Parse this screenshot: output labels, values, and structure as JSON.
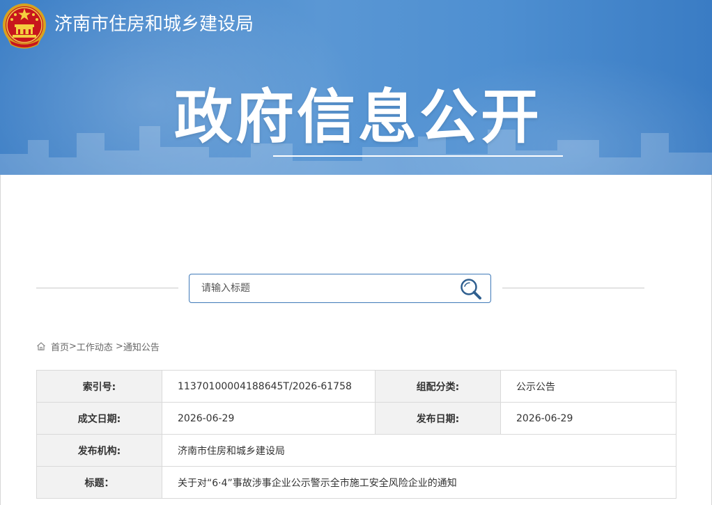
{
  "header": {
    "site_name": "济南市住房和城乡建设局",
    "banner_title": "政府信息公开",
    "emblem_icon": "national-emblem-icon",
    "banner_color": "#4a8bd0"
  },
  "search": {
    "placeholder": "请输入标题",
    "button_icon": "search-icon",
    "border_color": "#3f79b8"
  },
  "breadcrumb": {
    "home_icon": "home-icon",
    "items": [
      "首页",
      "工作动态",
      "通知公告"
    ],
    "separator": ">"
  },
  "info": {
    "index_label": "索引号:",
    "index_value": "11370100004188645T/2026-61758",
    "category_label": "组配分类:",
    "category_value": "公示公告",
    "created_label": "成文日期:",
    "created_value": "2026-06-29",
    "published_label": "发布日期:",
    "published_value": "2026-06-29",
    "org_label": "发布机构:",
    "org_value": "济南市住房和城乡建设局",
    "title_label": "标题：",
    "title_value": "关于对“6·4”事故涉事企业公示警示全市施工安全风险企业的通知"
  }
}
